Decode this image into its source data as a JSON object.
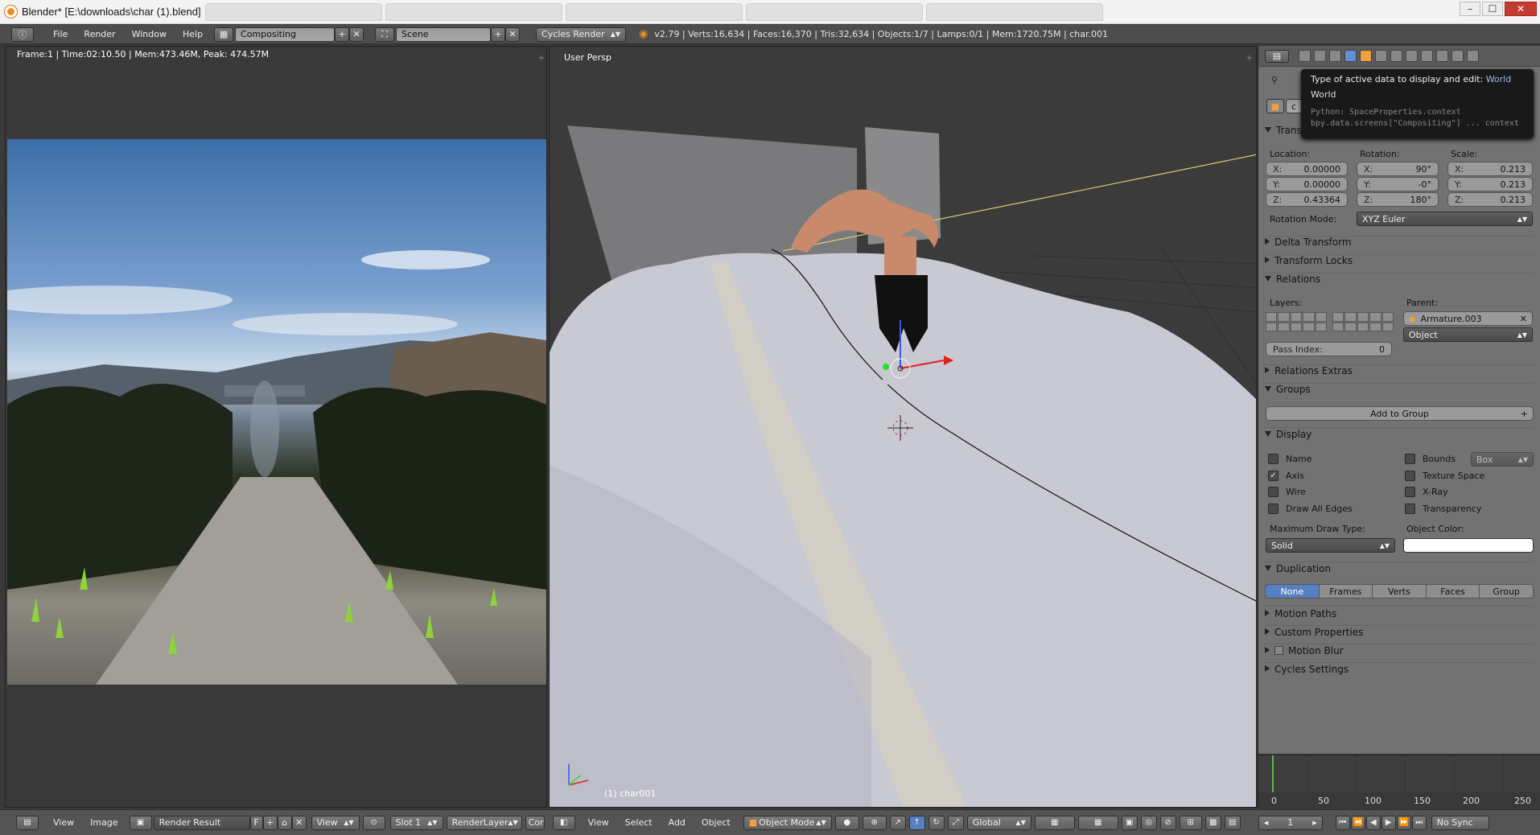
{
  "window": {
    "title": "Blender* [E:\\downloads\\char (1).blend]",
    "controls": {
      "minimize": "–",
      "maximize": "☐",
      "close": "✕"
    }
  },
  "info_header": {
    "menus": [
      "File",
      "Render",
      "Window",
      "Help"
    ],
    "layout": "Compositing",
    "scene": "Scene",
    "engine": "Cycles Render",
    "stats": "v2.79 | Verts:16,634 | Faces:16,370 | Tris:32,634 | Objects:1/7 | Lamps:0/1 | Mem:1720.75M | char.001"
  },
  "image_editor": {
    "render_stats": "Frame:1 | Time:02:10.50 | Mem:473.46M, Peak: 474.57M",
    "footer": {
      "view": "View",
      "image": "Image",
      "image_name": "Render Result",
      "fake_user": "F",
      "view_mode": "View",
      "slot": "Slot 1",
      "layer": "RenderLayer",
      "pass": "Cor"
    }
  },
  "viewport": {
    "label": "User Persp",
    "object_label": "(1) char001",
    "footer": {
      "view": "View",
      "select": "Select",
      "add": "Add",
      "object": "Object",
      "mode": "Object Mode",
      "orientation": "Global"
    }
  },
  "tooltip": {
    "title": "Type of active data to display and edit:",
    "value": "World",
    "line2": "World",
    "python1": "Python: SpaceProperties.context",
    "python2": "bpy.data.screens[\"Compositing\"] ... context"
  },
  "properties": {
    "context_field": "c",
    "transform": {
      "header": "Trans",
      "location_label": "Location:",
      "rotation_label": "Rotation:",
      "scale_label": "Scale:",
      "location": {
        "x": "0.00000",
        "y": "0.00000",
        "z": "0.43364"
      },
      "rotation": {
        "x": "90°",
        "y": "-0°",
        "z": "180°"
      },
      "scale": {
        "x": "0.213",
        "y": "0.213",
        "z": "0.213"
      },
      "axis_x": "X:",
      "axis_y": "Y:",
      "axis_z": "Z:",
      "rotation_mode_label": "Rotation Mode:",
      "rotation_mode": "XYZ Euler"
    },
    "delta_transform": "Delta Transform",
    "transform_locks": "Transform Locks",
    "relations": {
      "header": "Relations",
      "layers_label": "Layers:",
      "parent_label": "Parent:",
      "parent": "Armature.003",
      "parent_type": "Object",
      "pass_index_label": "Pass Index:",
      "pass_index": "0"
    },
    "relations_extras": "Relations Extras",
    "groups": {
      "header": "Groups",
      "add_button": "Add to Group"
    },
    "display": {
      "header": "Display",
      "name": "Name",
      "axis": "Axis",
      "wire": "Wire",
      "draw_all_edges": "Draw All Edges",
      "bounds": "Bounds",
      "bounds_type": "Box",
      "texture_space": "Texture Space",
      "xray": "X-Ray",
      "transparency": "Transparency",
      "max_draw_label": "Maximum Draw Type:",
      "max_draw": "Solid",
      "object_color_label": "Object Color:",
      "object_color": "#ffffff"
    },
    "duplication": {
      "header": "Duplication",
      "options": [
        "None",
        "Frames",
        "Verts",
        "Faces",
        "Group"
      ],
      "active": "None"
    },
    "motion_paths": "Motion Paths",
    "custom_properties": "Custom Properties",
    "motion_blur": "Motion Blur",
    "cycles_settings": "Cycles Settings"
  },
  "timeline": {
    "ticks": [
      "0",
      "50",
      "100",
      "150",
      "200",
      "250"
    ],
    "current_frame": "1",
    "sync": "No Sync"
  },
  "colors": {
    "accent": "#5680c2",
    "blender_orange": "#f08a24",
    "timeline_cursor": "#5fb94a"
  }
}
